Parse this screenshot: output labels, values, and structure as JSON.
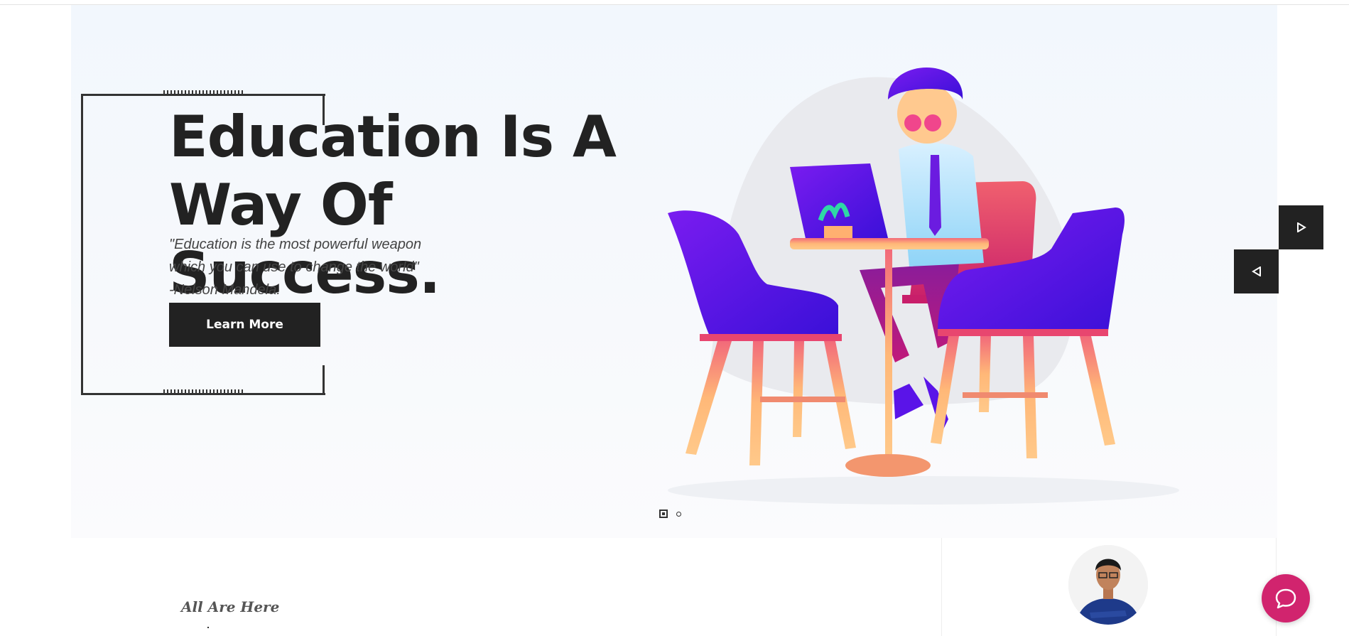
{
  "hero": {
    "headline_line1": "Education Is A",
    "headline_line2": "Way Of Success.",
    "quote_line1": "\"Education is the most powerful weapon",
    "quote_line2": "which you can use to change the world\"",
    "quote_author": "-Nelson Mandela.",
    "cta_label": "Learn More"
  },
  "slider": {
    "slide_count": 2,
    "active_slide": 1
  },
  "section": {
    "subtitle": "All Are Here"
  },
  "colors": {
    "dark": "#222222",
    "hero_bg": "#f4f8fd",
    "chat_accent": "#d1246e",
    "illustration_purple": "#5a12e8",
    "illustration_peach": "#ffc47a"
  },
  "icons": {
    "next": "play-right-icon",
    "prev": "play-left-icon",
    "chat": "chat-bubble-icon"
  }
}
